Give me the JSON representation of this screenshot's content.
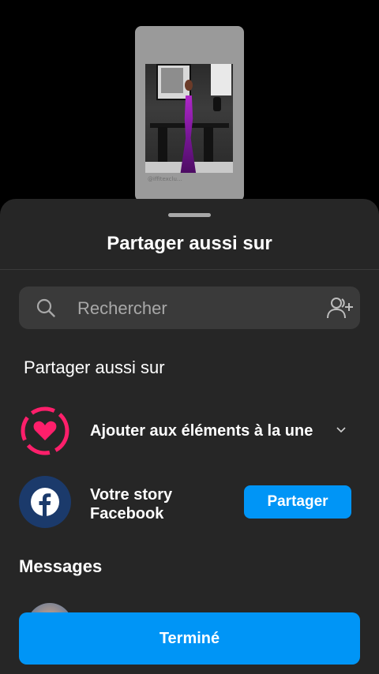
{
  "preview": {
    "caption": "@iffitexclu…"
  },
  "sheet": {
    "title": "Partager aussi sur"
  },
  "search": {
    "placeholder": "Rechercher"
  },
  "share_section": {
    "title": "Partager aussi sur",
    "highlight_label": "Ajouter aux éléments à la une",
    "facebook_line1": "Votre story",
    "facebook_line2": "Facebook",
    "share_button": "Partager"
  },
  "messages": {
    "title": "Messages"
  },
  "footer": {
    "done_button": "Terminé"
  },
  "colors": {
    "accent": "#0095f6",
    "highlight_pink": "#ff1f6b",
    "sheet_bg": "#262626"
  },
  "icons": [
    "search-icon",
    "add-people-icon",
    "highlight-heart-icon",
    "chevron-down-icon",
    "facebook-icon"
  ]
}
